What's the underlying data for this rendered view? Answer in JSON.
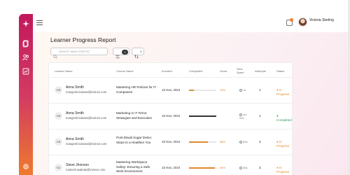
{
  "header": {
    "user_name": "Victoria Sterling"
  },
  "page": {
    "title": "Learner Progress Report"
  },
  "toolbar": {
    "search_placeholder": "Search name (Ctrl+K)",
    "filter_count": "0",
    "sort_count": "1"
  },
  "table": {
    "columns": [
      "Learner Name",
      "Course Name",
      "Enrolled",
      "Completed",
      "Score",
      "Time Spent",
      "Attempts",
      "Status"
    ],
    "rows": [
      {
        "initials": "AS",
        "name": "Anna Smith",
        "email": "mangesh.kanase@invince.com",
        "course": "Mastering HR Policies for IT Companies",
        "enrolled": "15 Nov, 2024",
        "completed_pct": 19,
        "completed_label": "19%",
        "score": "",
        "time": "7s",
        "attempts": "1",
        "status": "In Progress",
        "status_kind": "in"
      },
      {
        "initials": "AS",
        "name": "Anna Smith",
        "email": "mangesh.kanase@invince.com",
        "course": "Marketing in IT Firms: Strategies and Execution",
        "enrolled": "15 Nov, 2024",
        "completed_pct": 100,
        "completed_label": "",
        "score": "",
        "time": "1m 51s",
        "attempts": "1",
        "status": "Completed",
        "status_kind": "done"
      },
      {
        "initials": "AS",
        "name": "Anna Smith",
        "email": "mangesh.kanase@invince.com",
        "course": "Post-Diwali Sugar Detox: Steps to a Healthier You",
        "enrolled": "15 Nov, 2024",
        "completed_pct": 68,
        "completed_label": "68%",
        "score": "",
        "time": "63s",
        "attempts": "3",
        "status": "In Progress",
        "status_kind": "in"
      },
      {
        "initials": "SJ",
        "name": "Steve Jhonson",
        "email": "mahesh.waikale@invince.com",
        "course": "Mastering Workspace Safety: Ensuring a Safe Work Environment",
        "enrolled": "15 Nov, 2024",
        "completed_pct": 94,
        "completed_label": "94%",
        "score": "",
        "time": "35s",
        "attempts": "3",
        "status": "In Progress",
        "status_kind": "in"
      }
    ]
  },
  "colors": {
    "sidebar_top": "#c2185b",
    "sidebar_bottom": "#ef7b2c",
    "progress_fill": "#e08a2d",
    "status_in_progress": "#e08a2d",
    "status_completed": "#2e9e56"
  },
  "icons": {
    "sidebar": [
      "sparkle-icon",
      "document-icon",
      "users-icon",
      "chart-icon",
      "settings-icon"
    ],
    "topbar": [
      "menu-icon",
      "notification-icon"
    ]
  }
}
